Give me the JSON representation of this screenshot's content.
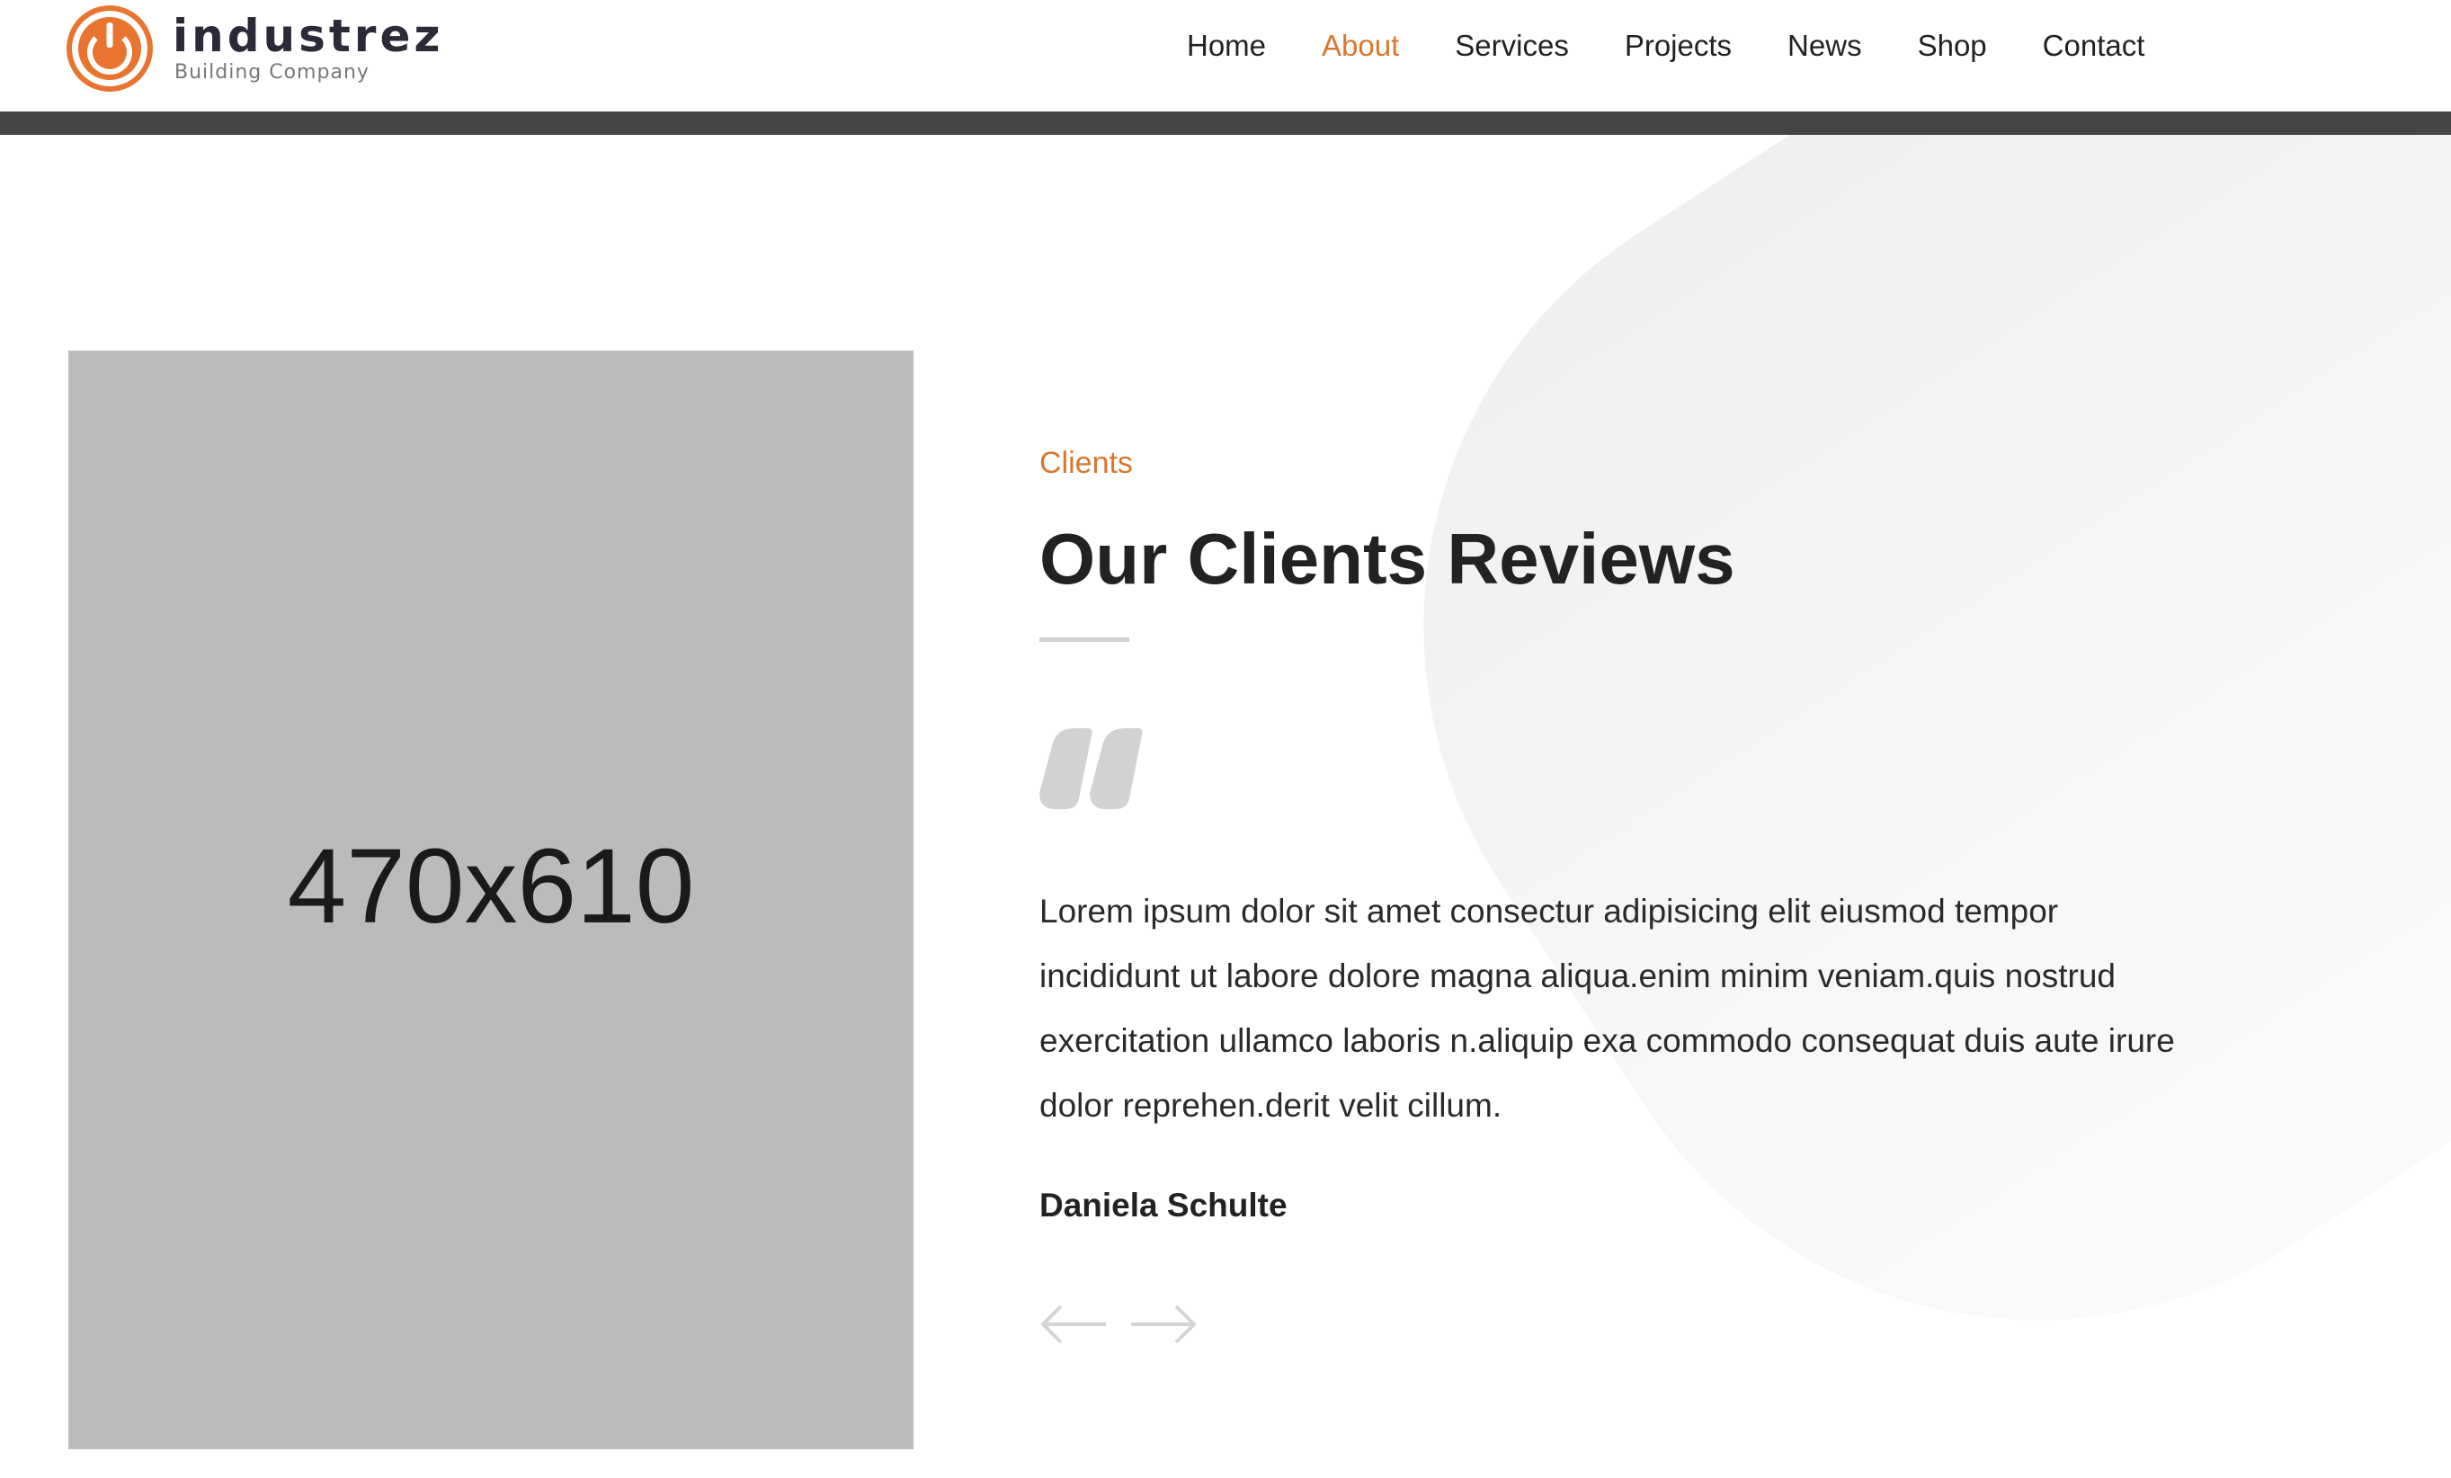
{
  "brand": {
    "name": "industrez",
    "tagline": "Building Company",
    "accent_color": "#d9772f"
  },
  "nav": {
    "items": [
      {
        "label": "Home",
        "active": false
      },
      {
        "label": "About",
        "active": true
      },
      {
        "label": "Services",
        "active": false
      },
      {
        "label": "Projects",
        "active": false
      },
      {
        "label": "News",
        "active": false
      },
      {
        "label": "Shop",
        "active": false
      },
      {
        "label": "Contact",
        "active": false
      }
    ]
  },
  "testimonial": {
    "image_placeholder": "470x610",
    "kicker": "Clients",
    "title": "Our Clients Reviews",
    "quote_icon": "quote-icon",
    "text": "Lorem ipsum dolor sit amet consectur adipisicing elit eiusmod tempor incididunt ut labore dolore magna aliqua.enim minim veniam.quis nostrud exercitation ullamco laboris n.aliquip exa commodo consequat duis aute irure dolor reprehen.derit velit cillum.",
    "author": "Daniela Schulte",
    "prev_icon": "arrow-left-icon",
    "next_icon": "arrow-right-icon"
  }
}
